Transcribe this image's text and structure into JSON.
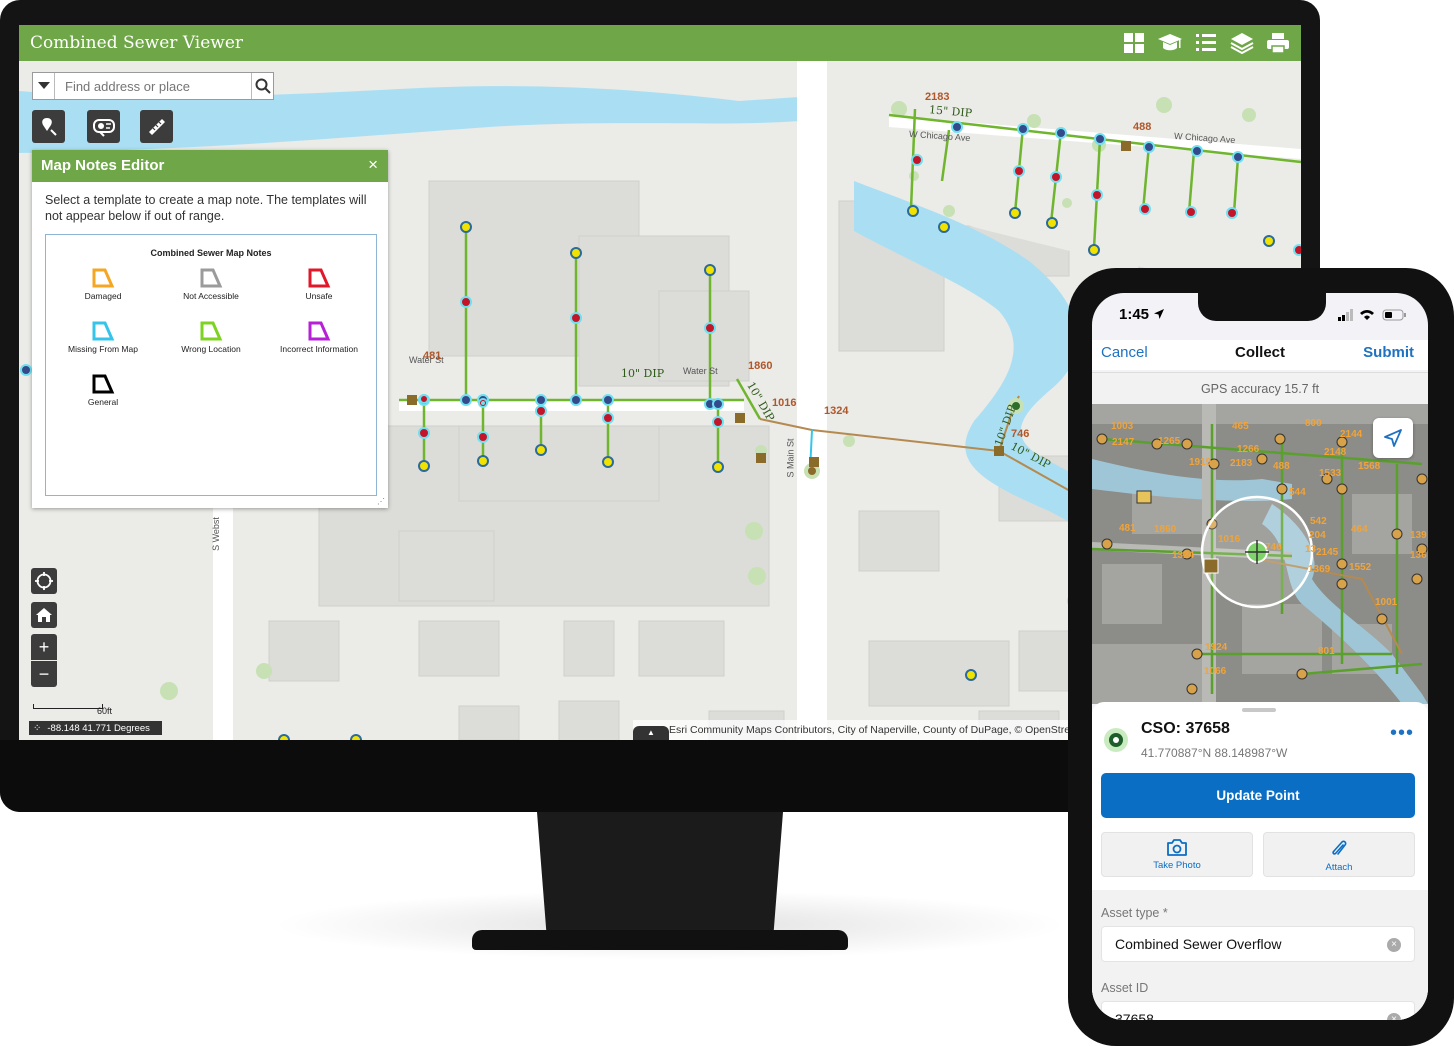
{
  "desktop": {
    "app_title": "Combined Sewer Viewer",
    "header_tools": [
      "grid-icon",
      "graduation-cap-icon",
      "list-icon",
      "layers-icon",
      "print-icon"
    ],
    "search": {
      "placeholder": "Find address or place"
    },
    "tools": [
      "map-note-icon",
      "identify-icon",
      "measure-icon"
    ],
    "map_notes_editor": {
      "title": "Map Notes Editor",
      "close": "×",
      "description": "Select a template to create a map note. The templates will not appear below if out of range.",
      "templates_title": "Combined Sewer Map Notes",
      "templates": [
        {
          "label": "Damaged",
          "color": "#f5a623"
        },
        {
          "label": "Not Accessible",
          "color": "#9b9b9b"
        },
        {
          "label": "Unsafe",
          "color": "#e2182a"
        },
        {
          "label": "Missing From Map",
          "color": "#35c5ea"
        },
        {
          "label": "Wrong Location",
          "color": "#7ed321"
        },
        {
          "label": "Incorrect Information",
          "color": "#b620d6"
        },
        {
          "label": "General",
          "color": "#000000"
        }
      ]
    },
    "map": {
      "street_labels": [
        "W Chicago Ave",
        "W Chicago Ave",
        "Water St",
        "Water St",
        "S Main St",
        "S Webst"
      ],
      "pipe_labels": [
        "15\" DIP",
        "10\" DIP",
        "10\" DIP",
        "10\" DIP",
        "10\" DIP"
      ],
      "asset_ids": [
        "2183",
        "488",
        "481",
        "1860",
        "1016",
        "1324",
        "746"
      ],
      "scale": "60ft",
      "coordinates": "-88.148 41.771 Degrees",
      "attribution": "Esri Community Maps Contributors, City of Naperville, County of DuPage, © OpenStreetMap"
    },
    "colors": {
      "header": "#6fa748",
      "water": "#aadff3",
      "sewer_line": "#6fb52e",
      "force_main": "#b58a50"
    }
  },
  "phone": {
    "status_time": "1:45",
    "nav": {
      "cancel": "Cancel",
      "title": "Collect",
      "submit": "Submit"
    },
    "gps_accuracy": "GPS accuracy 15.7 ft",
    "map_labels": [
      "1003",
      "2147",
      "1265",
      "1919",
      "465",
      "1266",
      "800",
      "2144",
      "74",
      "2148",
      "2183",
      "488",
      "1568",
      "1533",
      "544",
      "1860",
      "481",
      "542",
      "464",
      "204",
      "1016",
      "1324",
      "746",
      "2145",
      "1369",
      "1552",
      "1001",
      "1924",
      "1066",
      "801",
      "13",
      "139",
      "136"
    ],
    "feature": {
      "title": "CSO: 37658",
      "coords": "41.770887°N  88.148987°W",
      "more": "•••"
    },
    "update_button": "Update Point",
    "actions": {
      "take_photo": "Take Photo",
      "attach": "Attach"
    },
    "fields": {
      "asset_type_label": "Asset type *",
      "asset_type_value": "Combined Sewer Overflow",
      "asset_id_label": "Asset ID",
      "asset_id_value": "37658"
    }
  }
}
